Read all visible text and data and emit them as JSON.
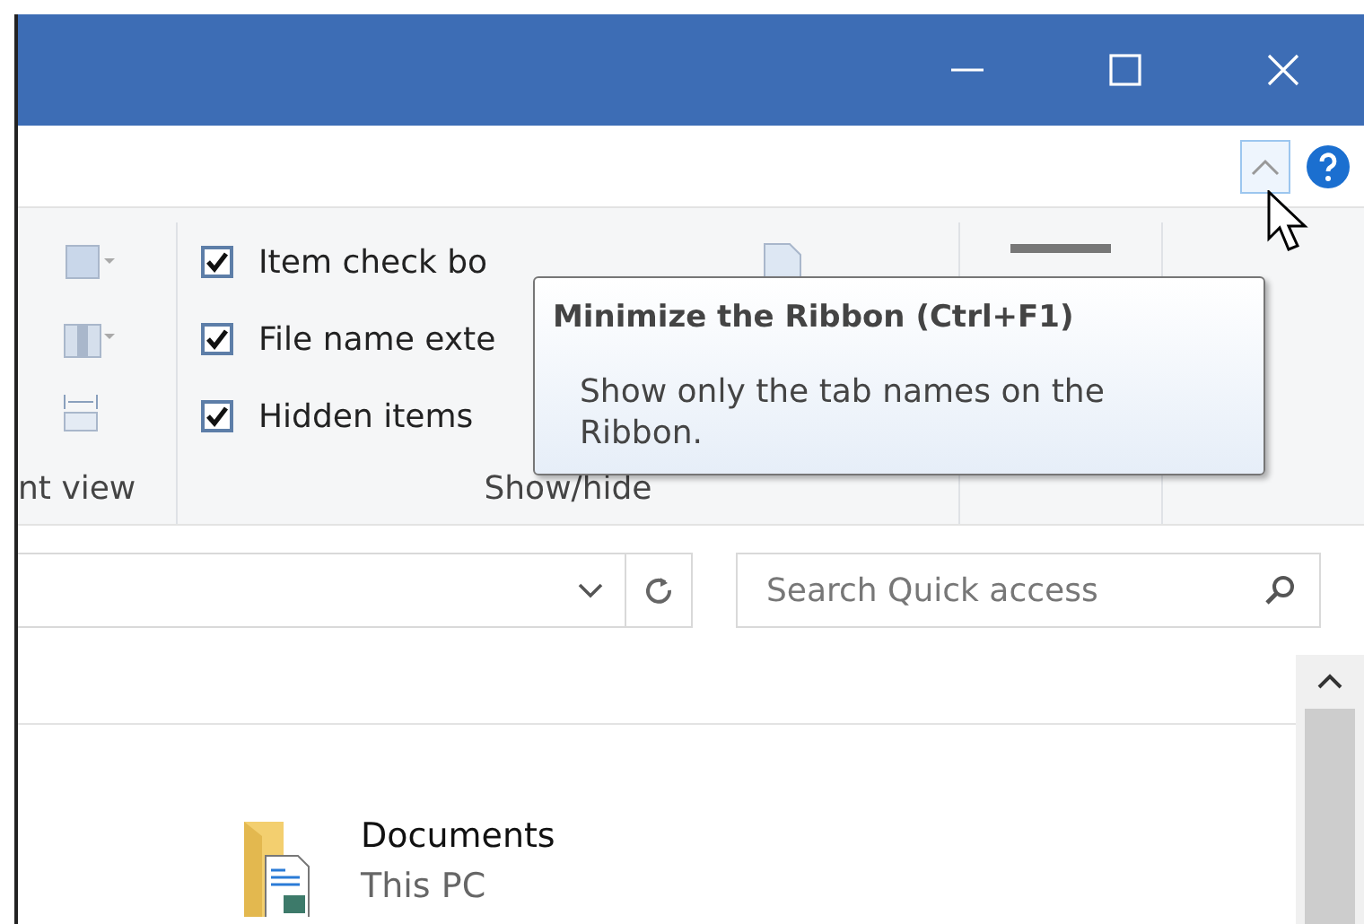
{
  "ribbon": {
    "groups": [
      {
        "label": "nt view"
      },
      {
        "label": "Show/hide",
        "checkboxes": [
          {
            "label": "Item check bo",
            "checked": true
          },
          {
            "label": "File name exte",
            "checked": true
          },
          {
            "label": "Hidden items",
            "checked": true
          }
        ]
      }
    ]
  },
  "tooltip": {
    "title": "Minimize the Ribbon (Ctrl+F1)",
    "text": "Show only the tab names on the Ribbon."
  },
  "search": {
    "placeholder": "Search Quick access"
  },
  "items": [
    {
      "name": "Documents",
      "location": "This PC"
    }
  ]
}
